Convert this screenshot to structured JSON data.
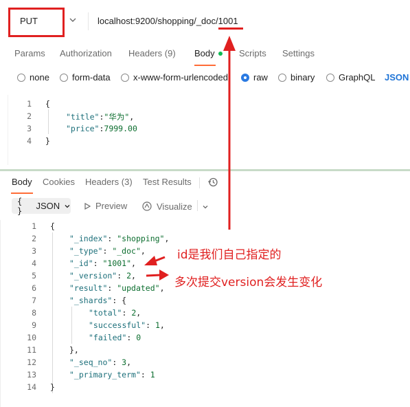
{
  "request": {
    "method": "PUT",
    "url": "localhost:9200/shopping/_doc/1001",
    "tabs": [
      {
        "label": "Params"
      },
      {
        "label": "Authorization"
      },
      {
        "label": "Headers",
        "count": "(9)"
      },
      {
        "label": "Body"
      },
      {
        "label": "Scripts"
      },
      {
        "label": "Settings"
      }
    ],
    "body_types": [
      "none",
      "form-data",
      "x-www-form-urlencoded",
      "raw",
      "binary",
      "GraphQL"
    ],
    "selected_body_type": "raw",
    "body_format": "JSON",
    "body_lines": [
      {
        "n": "1",
        "text": "{"
      },
      {
        "n": "2",
        "key": "\"title\"",
        "sep": ":",
        "val": "\"华为\"",
        "end": ","
      },
      {
        "n": "3",
        "key": "\"price\"",
        "sep": ":",
        "val": "7999.00",
        "end": ""
      },
      {
        "n": "4",
        "text": "}"
      }
    ]
  },
  "response": {
    "tabs": [
      {
        "label": "Body"
      },
      {
        "label": "Cookies"
      },
      {
        "label": "Headers",
        "count": "(3)"
      },
      {
        "label": "Test Results"
      }
    ],
    "format": "JSON",
    "format_icon": "{ }",
    "preview_label": "Preview",
    "visualize_label": "Visualize",
    "lines": [
      {
        "n": "1",
        "text": "{"
      },
      {
        "n": "2",
        "key": "\"_index\"",
        "val": "\"shopping\"",
        "end": ","
      },
      {
        "n": "3",
        "key": "\"_type\"",
        "val": "\"_doc\"",
        "end": ","
      },
      {
        "n": "4",
        "key": "\"_id\"",
        "val": "\"1001\"",
        "end": ","
      },
      {
        "n": "5",
        "key": "\"_version\"",
        "val": "2",
        "end": ","
      },
      {
        "n": "6",
        "key": "\"result\"",
        "val": "\"updated\"",
        "end": ","
      },
      {
        "n": "7",
        "key": "\"_shards\"",
        "val": "{",
        "end": ""
      },
      {
        "n": "8",
        "key": "\"total\"",
        "val": "2",
        "end": ","
      },
      {
        "n": "9",
        "key": "\"successful\"",
        "val": "1",
        "end": ","
      },
      {
        "n": "10",
        "key": "\"failed\"",
        "val": "0",
        "end": ""
      },
      {
        "n": "11",
        "text": "},"
      },
      {
        "n": "12",
        "key": "\"_seq_no\"",
        "val": "3",
        "end": ","
      },
      {
        "n": "13",
        "key": "\"_primary_term\"",
        "val": "1",
        "end": ""
      },
      {
        "n": "14",
        "text": "}"
      }
    ]
  },
  "annotations": {
    "id_note": "id是我们自己指定的",
    "version_note": "多次提交version会发生变化"
  },
  "colors": {
    "highlight_red": "#e02020",
    "active_tab_underline": "#ff6c37",
    "json_link": "#1f74d6"
  }
}
